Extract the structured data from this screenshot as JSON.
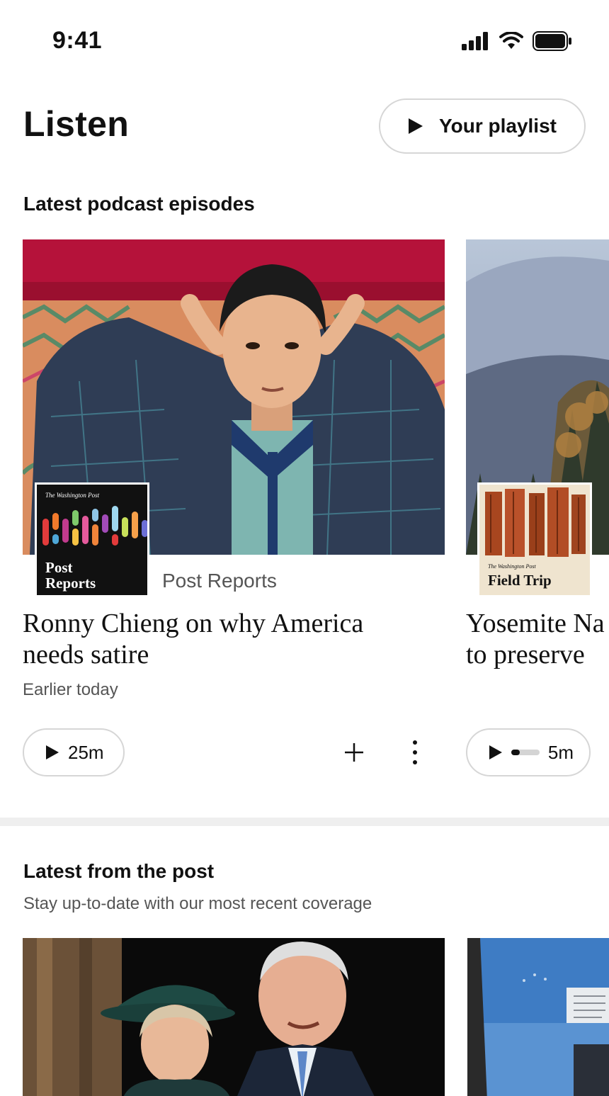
{
  "status": {
    "time": "9:41",
    "icons": [
      "cellular-signal-icon",
      "wifi-icon",
      "battery-icon"
    ]
  },
  "header": {
    "title": "Listen",
    "playlist_button": {
      "label": "Your playlist",
      "icon": "play-icon"
    }
  },
  "podcasts": {
    "heading": "Latest podcast episodes",
    "episodes": [
      {
        "show": "Post Reports",
        "thumbnail_lines": [
          "The Washington Post",
          "Post",
          "Reports"
        ],
        "title": "Ronny Chieng on why America needs satire",
        "date": "Earlier today",
        "duration": "25m",
        "progress": 0
      },
      {
        "show": "",
        "thumbnail_lines": [
          "The Washington Post",
          "Field Trip"
        ],
        "title": "Yosemite Na\nto preserve",
        "date": "",
        "duration": "5m",
        "progress": 0.3
      }
    ]
  },
  "latest": {
    "heading": "Latest from the post",
    "subtitle": "Stay up-to-date with our most recent coverage"
  },
  "colors": {
    "accent": "#111111",
    "muted_text": "#555555",
    "border": "#d6d6d6",
    "divider": "#efefef"
  }
}
